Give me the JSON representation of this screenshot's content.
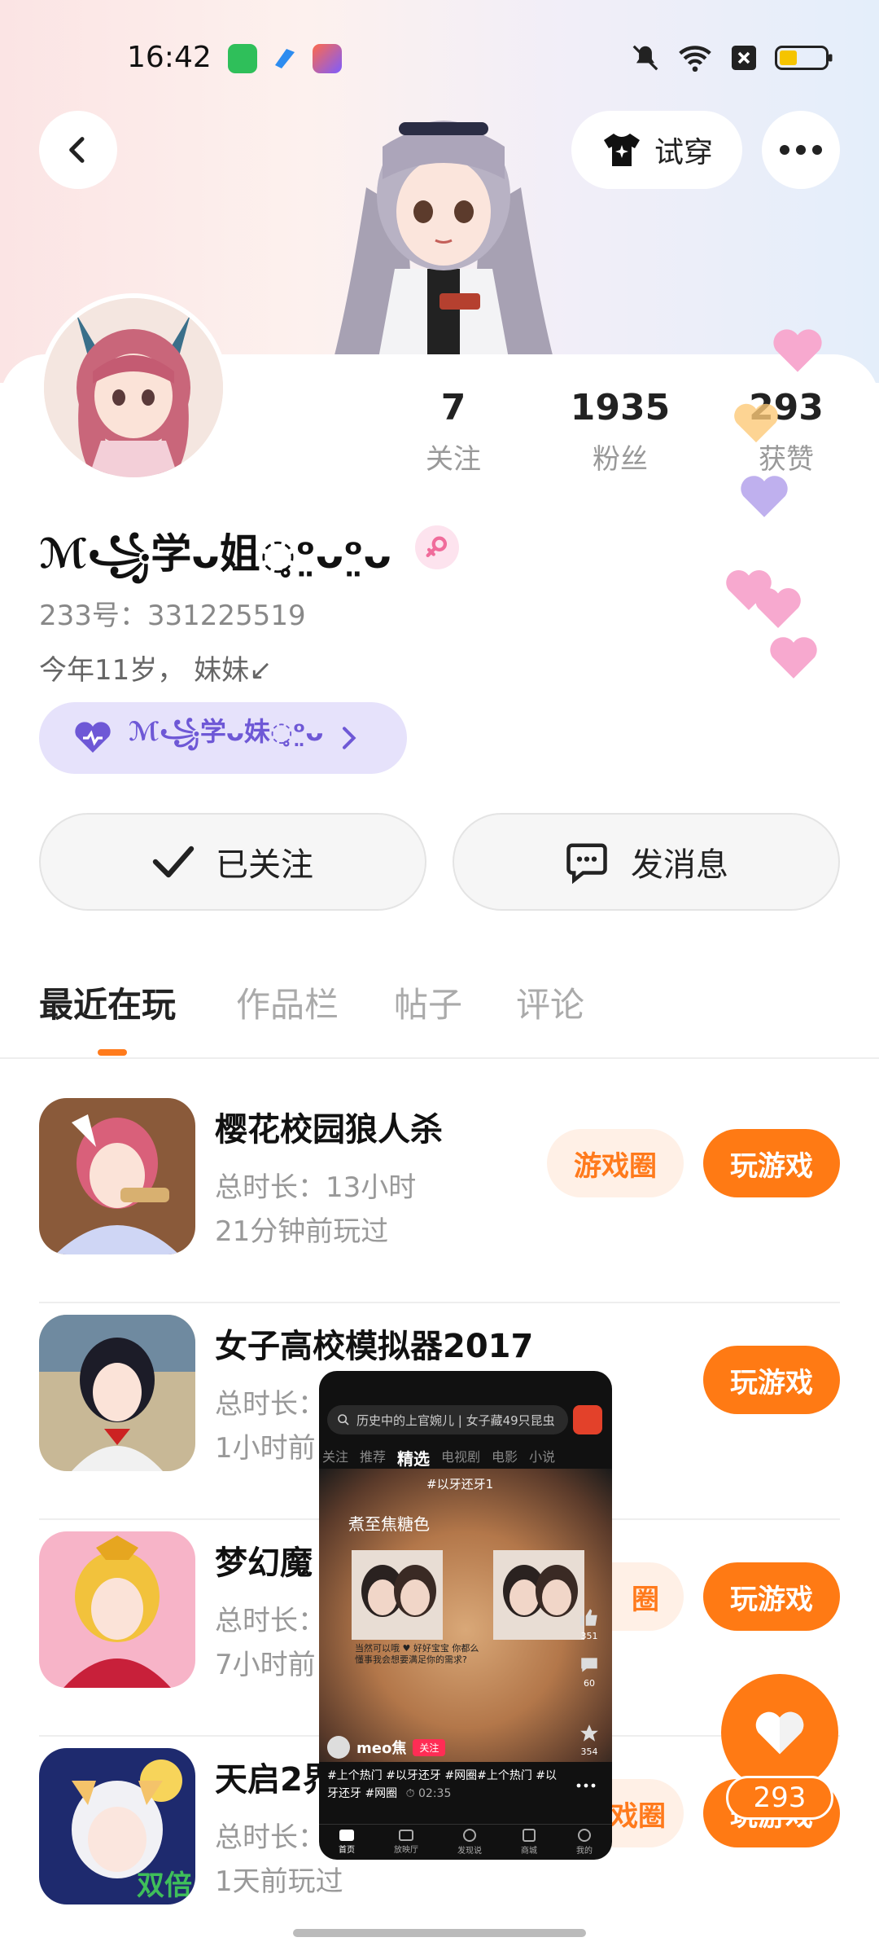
{
  "status_bar": {
    "time": "16:42"
  },
  "header": {
    "try_on_label": "试穿"
  },
  "profile": {
    "stats": [
      {
        "value": "7",
        "label": "关注"
      },
      {
        "value": "1935",
        "label": "粉丝"
      },
      {
        "value": "293",
        "label": "获赞"
      }
    ],
    "username": "ℳ꧁学ᴗ姐◌̥ᵒ̤ᴗᵒ̤ᴗ",
    "uid": "233号：331225519",
    "bio": "今年11岁， 妹妹↙",
    "fan_badge": "ℳ꧁学ᴗ妹◌̥ᵒ̤ᴗ",
    "followed_label": "已关注",
    "message_label": "发消息"
  },
  "tabs": [
    {
      "label": "最近在玩"
    },
    {
      "label": "作品栏"
    },
    {
      "label": "帖子"
    },
    {
      "label": "评论"
    }
  ],
  "games": [
    {
      "title": "樱花校园狼人杀",
      "duration": "总时长：13小时",
      "last_played": "21分钟前玩过",
      "circle_label": "游戏圈",
      "play_label": "玩游戏"
    },
    {
      "title": "女子高校模拟器2017",
      "duration": "总时长：",
      "last_played": "1小时前",
      "circle_label": "",
      "play_label": "玩游戏"
    },
    {
      "title": "梦幻魔",
      "duration": "总时长：",
      "last_played": "7小时前",
      "circle_label": "圈",
      "play_label": "玩游戏"
    },
    {
      "title": "天启2界",
      "duration": "总时长：",
      "last_played": "1天前玩过",
      "circle_label": "戏圈",
      "play_label": "玩游戏"
    }
  ],
  "video_overlay": {
    "search_text": "历史中的上官婉儿 | 女子藏49只昆虫",
    "nav": [
      "关注",
      "推荐",
      "精选",
      "电视剧",
      "电影",
      "小说"
    ],
    "hashtag_top": "#以牙还牙1",
    "caption_top": "煮至焦糖色",
    "caption_mid": "当然可以哦 ♥ 好好宝宝 你都么懂事我会想要满足你的需求?",
    "author": "meo焦",
    "follow": "关注",
    "desc": "#上个热门 #以牙还牙 #网圈#上个热门 #以牙还牙 #网圈",
    "duration": "02:35",
    "side_counts": [
      "351",
      "60",
      "354"
    ],
    "bottom_tabs": [
      "首页",
      "放映厅",
      "发现说",
      "商城",
      "我的"
    ]
  },
  "like_fab": {
    "count": "293"
  }
}
